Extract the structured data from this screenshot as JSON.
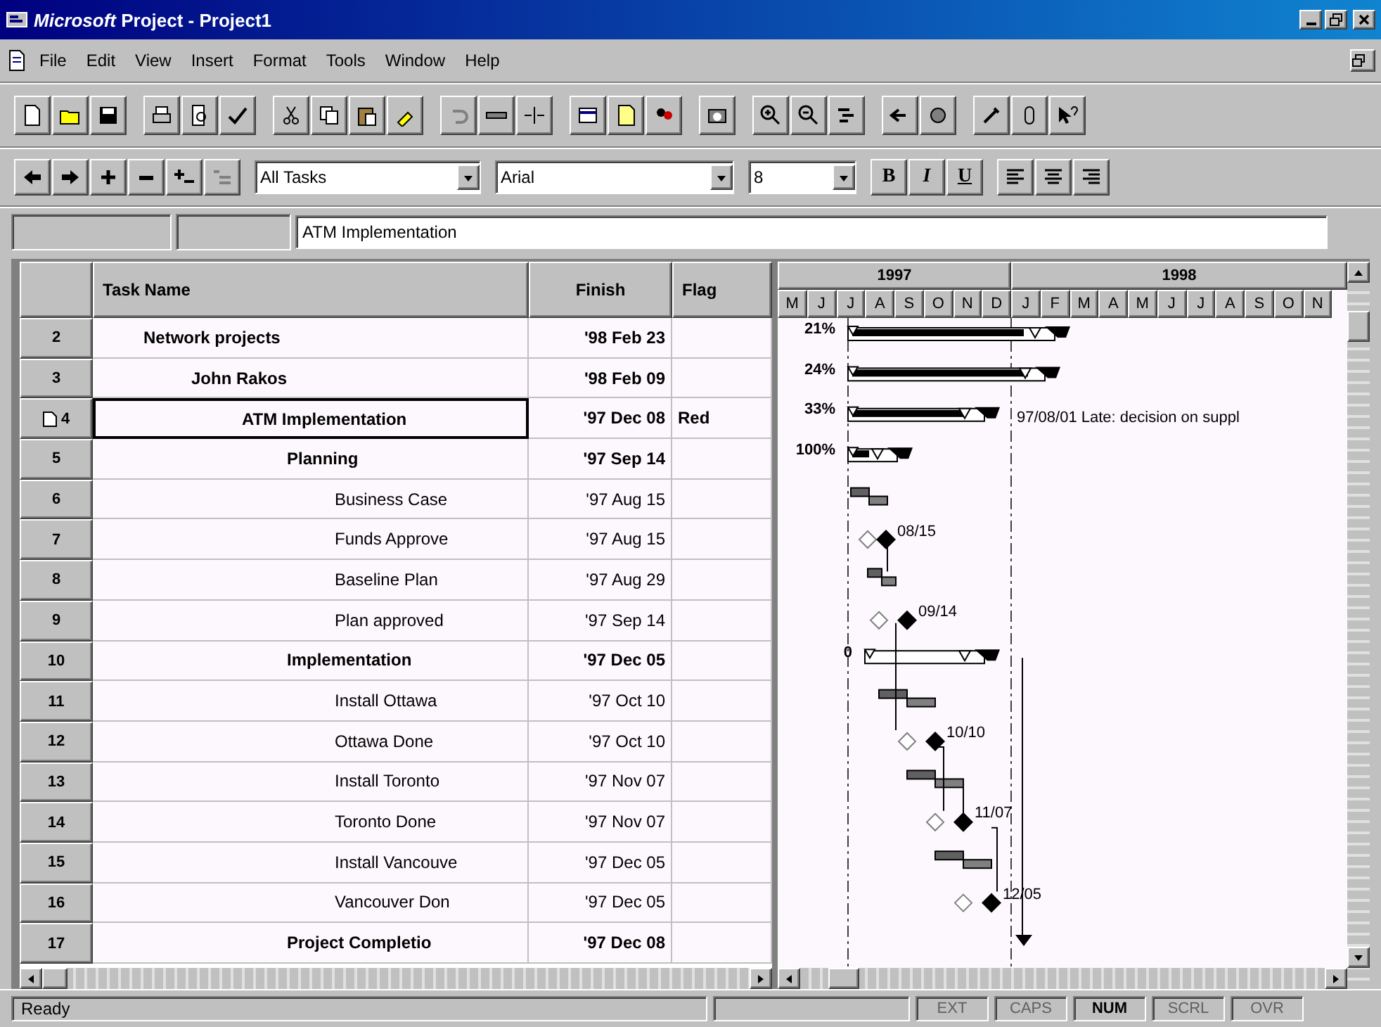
{
  "window": {
    "title": "*Microsoft* Project - Project1"
  },
  "menu": [
    "File",
    "Edit",
    "View",
    "Insert",
    "Format",
    "Tools",
    "Window",
    "Help"
  ],
  "formatting": {
    "filter": "All Tasks",
    "font": "Arial",
    "size": "8",
    "styles": [
      {
        "label": "B",
        "kind": "bold"
      },
      {
        "label": "I",
        "kind": "italic"
      },
      {
        "label": "U",
        "kind": "underline"
      }
    ]
  },
  "entry_bar": {
    "value": "ATM Implementation"
  },
  "table": {
    "columns": [
      "Task Name",
      "Finish",
      "Flag"
    ],
    "tasks": [
      {
        "id": "2",
        "name": "Network projects",
        "finish": "'98 Feb 23",
        "kind": "summary",
        "selected": false,
        "note": false,
        "bar_label": "21%",
        "children": [
          {
            "id": "3",
            "name": "John Rakos",
            "finish": "'98 Feb 09",
            "kind": "summary",
            "selected": false,
            "note": false,
            "bar_label": "24%",
            "children": [
              {
                "id": "4",
                "name": "ATM Implementation",
                "finish": "'97 Dec 08",
                "flag": "Red",
                "kind": "summary",
                "selected": true,
                "note": true,
                "bar_label": "33%",
                "bar_note": "97/08/01 Late: decision on suppl",
                "children": [
                  {
                    "id": "5",
                    "name": "Planning",
                    "finish": "'97 Sep 14",
                    "kind": "summary",
                    "selected": false,
                    "note": false,
                    "bar_label": "100%",
                    "children": [
                      {
                        "id": "6",
                        "name": "Business Case",
                        "finish": "'97 Aug 15",
                        "kind": "task",
                        "selected": false,
                        "note": false
                      },
                      {
                        "id": "7",
                        "name": "Funds Approve",
                        "finish": "'97 Aug 15",
                        "kind": "milestone",
                        "selected": false,
                        "note": false,
                        "bar_label": "08/15"
                      },
                      {
                        "id": "8",
                        "name": "Baseline Plan",
                        "finish": "'97 Aug 29",
                        "kind": "task",
                        "selected": false,
                        "note": false
                      },
                      {
                        "id": "9",
                        "name": "Plan approved",
                        "finish": "'97 Sep 14",
                        "kind": "milestone",
                        "selected": false,
                        "note": false,
                        "bar_label": "09/14"
                      }
                    ]
                  },
                  {
                    "id": "10",
                    "name": "Implementation",
                    "finish": "'97 Dec 05",
                    "kind": "summary",
                    "selected": false,
                    "note": false,
                    "bar_label": "0",
                    "children": [
                      {
                        "id": "11",
                        "name": "Install Ottawa",
                        "finish": "'97 Oct 10",
                        "kind": "task",
                        "selected": false,
                        "note": false
                      },
                      {
                        "id": "12",
                        "name": "Ottawa Done",
                        "finish": "'97 Oct 10",
                        "kind": "milestone",
                        "selected": false,
                        "note": false,
                        "bar_label": "10/10"
                      },
                      {
                        "id": "13",
                        "name": "Install Toronto",
                        "finish": "'97 Nov 07",
                        "kind": "task",
                        "selected": false,
                        "note": false
                      },
                      {
                        "id": "14",
                        "name": "Toronto Done",
                        "finish": "'97 Nov 07",
                        "kind": "milestone",
                        "selected": false,
                        "note": false,
                        "bar_label": "11/07"
                      },
                      {
                        "id": "15",
                        "name": "Install Vancouve",
                        "finish": "'97 Dec 05",
                        "kind": "task",
                        "selected": false,
                        "note": false
                      },
                      {
                        "id": "16",
                        "name": "Vancouver Don",
                        "finish": "'97 Dec 05",
                        "kind": "milestone",
                        "selected": false,
                        "note": false,
                        "bar_label": "12/05"
                      }
                    ]
                  },
                  {
                    "id": "17",
                    "name": "Project Completio",
                    "finish": "'97 Dec 08",
                    "kind": "summary",
                    "selected": false,
                    "note": false
                  }
                ]
              }
            ]
          }
        ]
      }
    ]
  },
  "timescale": {
    "years": [
      "1997",
      "1998"
    ],
    "months": [
      "M",
      "J",
      "J",
      "A",
      "S",
      "O",
      "N",
      "D",
      "J",
      "F",
      "M",
      "A",
      "M",
      "J",
      "J",
      "A",
      "S",
      "O",
      "N"
    ]
  },
  "status_bar": {
    "message": "Ready",
    "indicators": [
      {
        "label": "EXT",
        "on": false
      },
      {
        "label": "CAPS",
        "on": false
      },
      {
        "label": "NUM",
        "on": true
      },
      {
        "label": "SCRL",
        "on": false
      },
      {
        "label": "OVR",
        "on": false
      }
    ]
  }
}
